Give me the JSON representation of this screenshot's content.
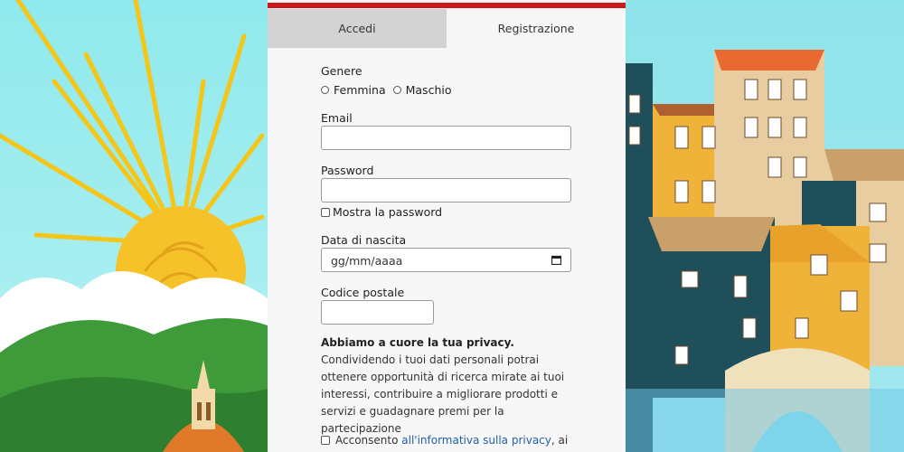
{
  "tabs": [
    {
      "label": "Accedi",
      "active": false
    },
    {
      "label": "Registrazione",
      "active": true
    }
  ],
  "form": {
    "gender_label": "Genere",
    "gender_options": [
      "Femmina",
      "Maschio"
    ],
    "email_label": "Email",
    "email_value": "",
    "password_label": "Password",
    "password_value": "",
    "show_password_label": "Mostra la password",
    "dob_label": "Data di nascita",
    "dob_placeholder": "gg/mm/aaaa",
    "postal_label": "Codice postale",
    "postal_value": "",
    "privacy_heading": "Abbiamo a cuore la tua privacy.",
    "privacy_text": "Condividendo i tuoi dati personali potrai ottenere opportunità di ricerca mirate ai tuoi interessi, contribuire a migliorare prodotti e servizi e guadagnare premi per la partecipazione",
    "consent_prefix": "Acconsento ",
    "consent_link": "all'informativa sulla privacy",
    "consent_suffix": ", ai"
  },
  "colors": {
    "accent": "#cc1a1a",
    "link": "#1f5fa8",
    "tab_inactive": "#d3d3d3"
  },
  "icons": [
    "calendar-icon"
  ]
}
